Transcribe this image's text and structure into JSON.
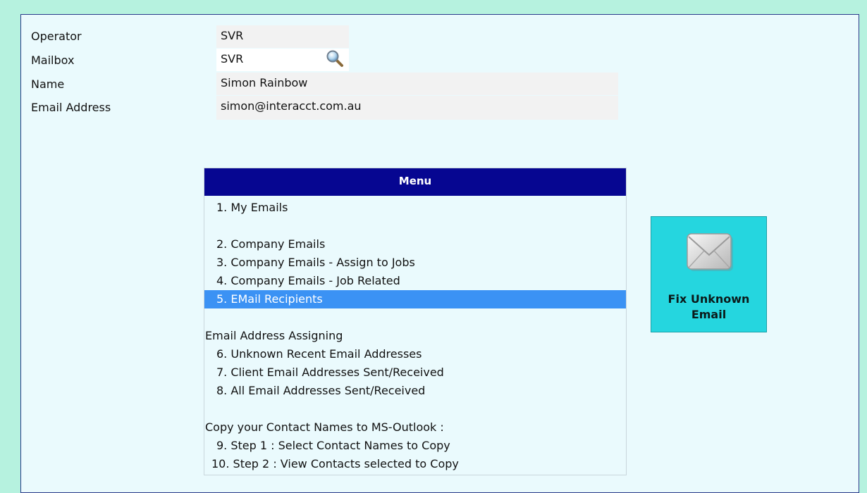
{
  "form": {
    "operator_label": "Operator",
    "operator_value": "SVR",
    "mailbox_label": "Mailbox",
    "mailbox_value": "SVR",
    "name_label": "Name",
    "name_value": "Simon Rainbow",
    "email_label": "Email Address",
    "email_value": "simon@interacct.com.au"
  },
  "menu": {
    "title": "Menu",
    "items": [
      "1. My Emails",
      "2. Company Emails",
      "3. Company Emails - Assign to Jobs",
      "4. Company Emails - Job Related",
      "5. EMail Recipients",
      "Email Address Assigning",
      "6. Unknown Recent Email Addresses",
      "7. Client Email Addresses Sent/Received",
      "8. All Email Addresses Sent/Received",
      "Copy your Contact Names to MS-Outlook :",
      "9. Step 1 : Select Contact Names to Copy",
      "10. Step 2 : View Contacts selected to Copy"
    ],
    "selected_item": "5. EMail Recipients"
  },
  "fix_button": {
    "label": "Fix Unknown Email",
    "icon": "envelope-icon"
  },
  "colors": {
    "background": "#b6f2df",
    "panel": "#eafafd",
    "menu_header": "#060691",
    "selected": "#3b92f4",
    "fix_button": "#25d6df"
  }
}
